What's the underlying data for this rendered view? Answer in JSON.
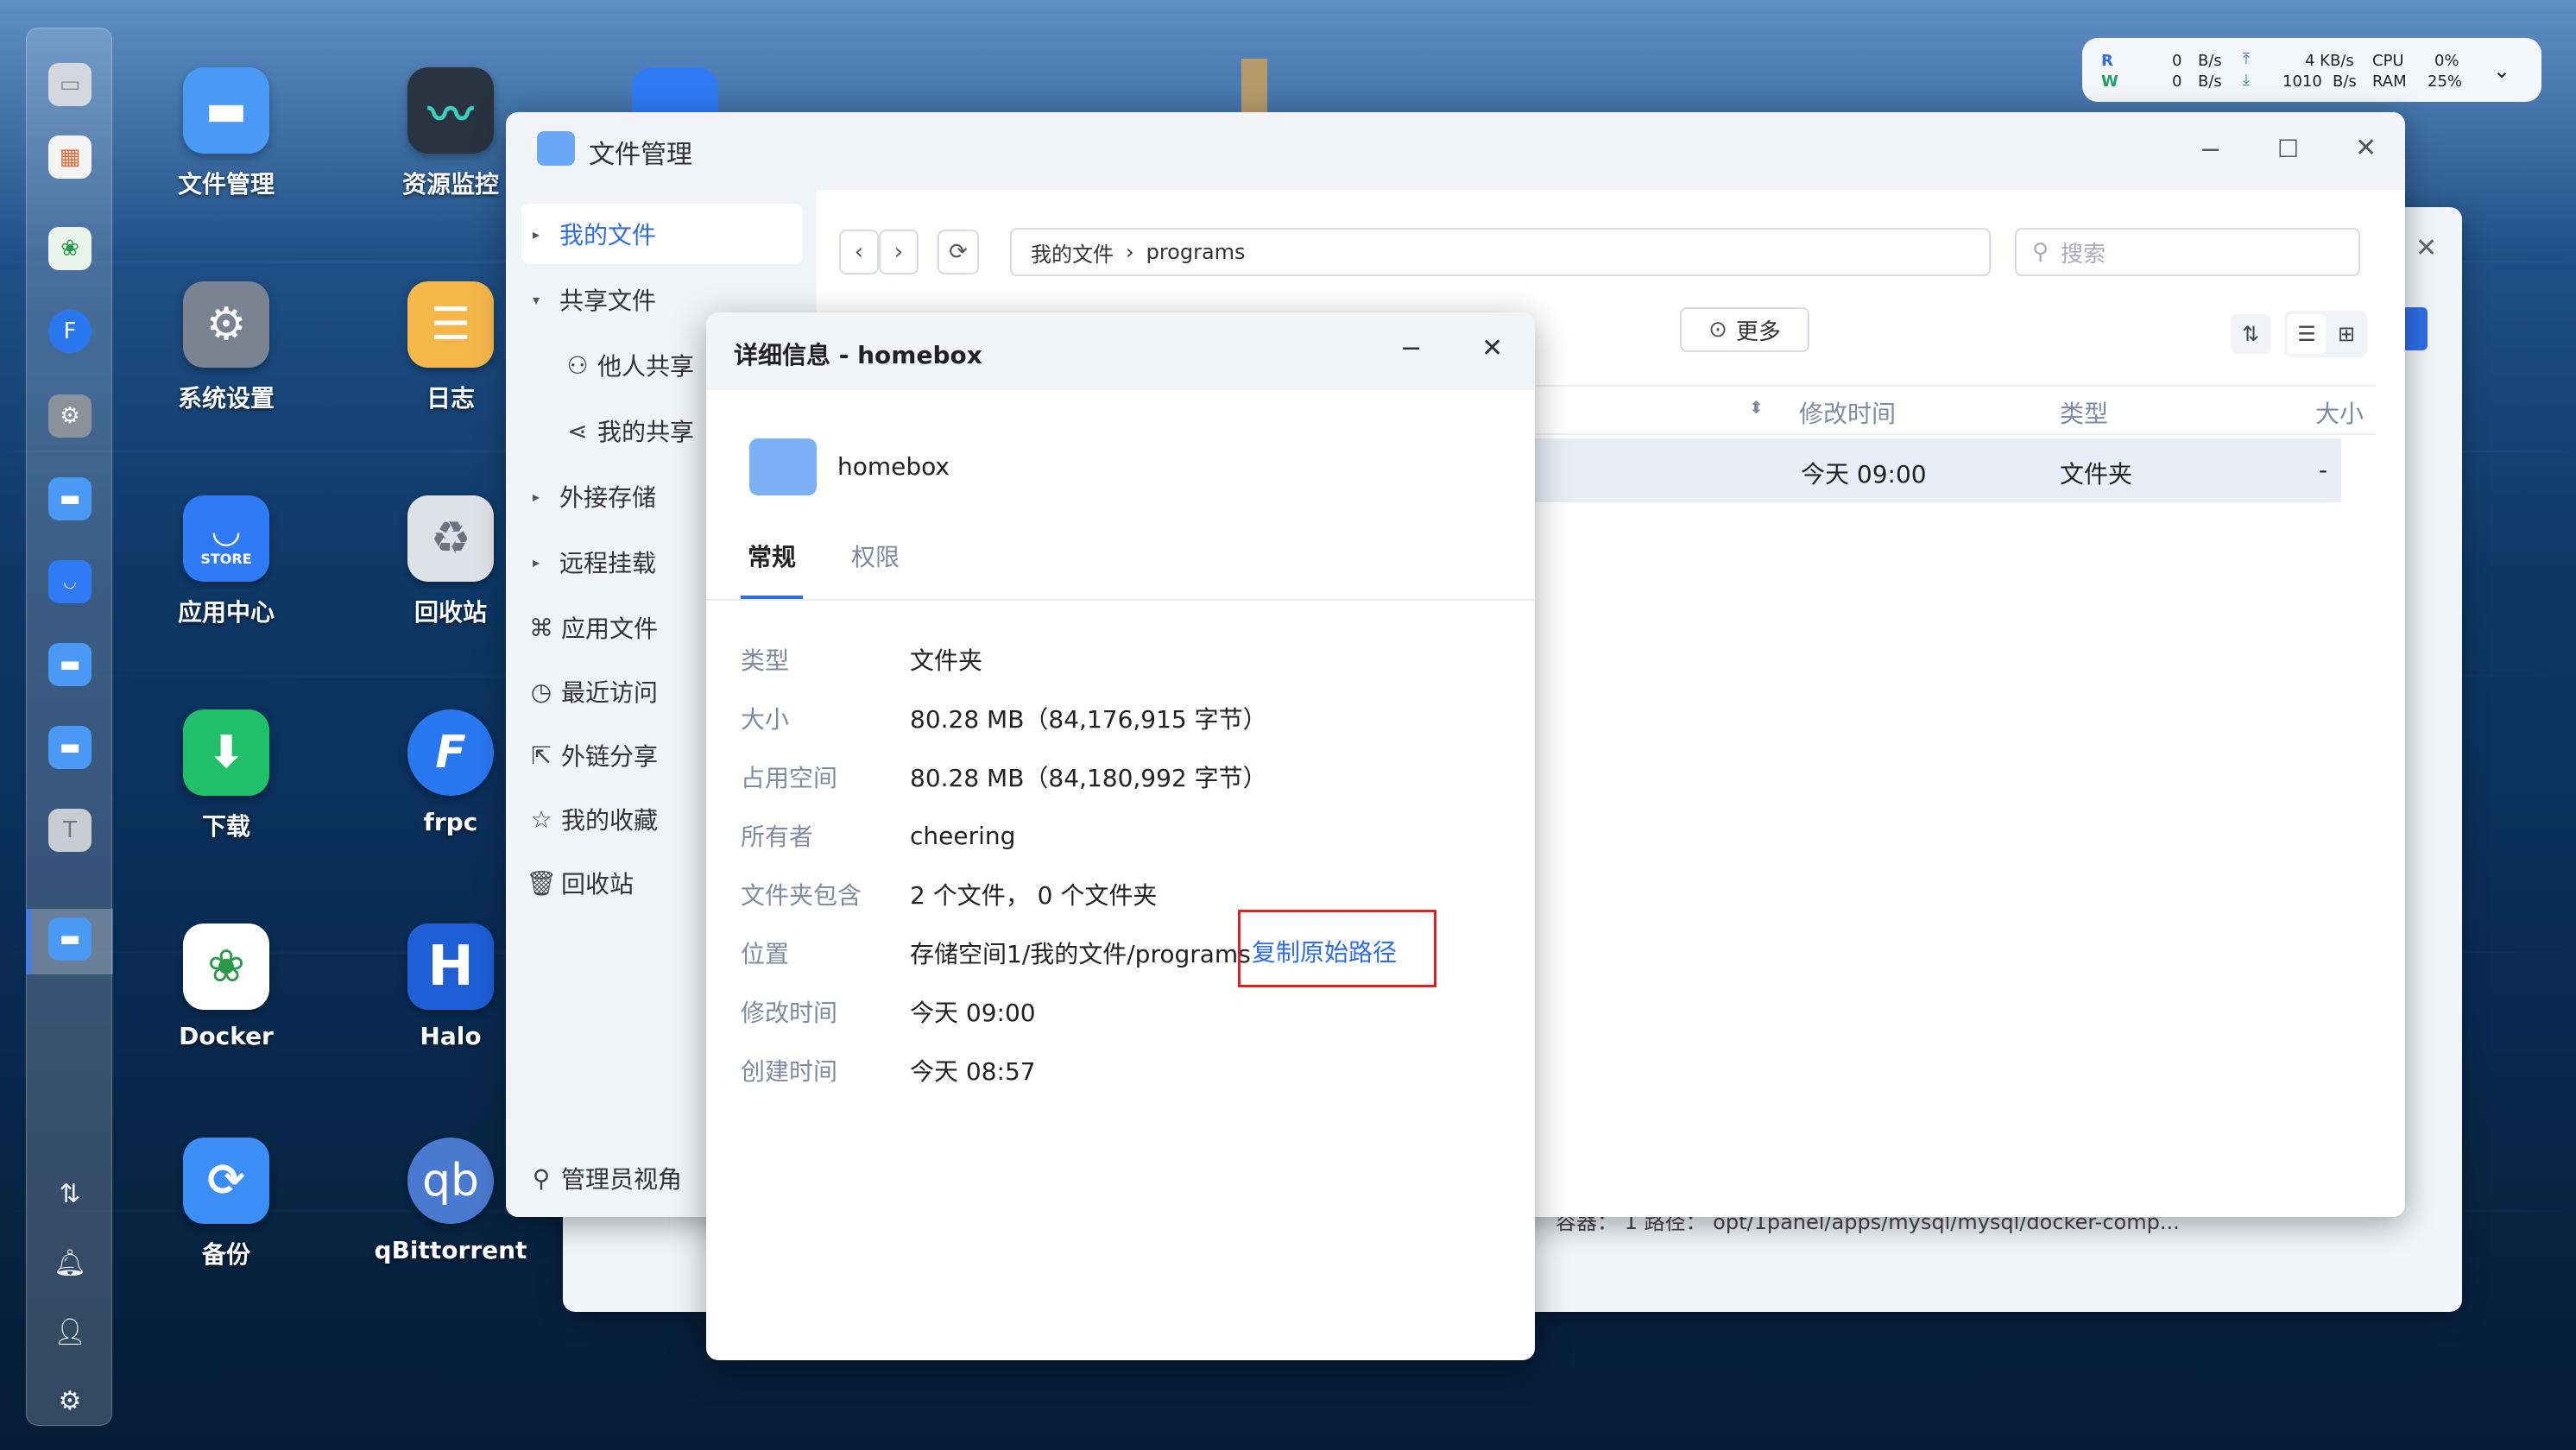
{
  "desktop": {
    "icons": [
      {
        "label": "文件管理",
        "icon": "folder-icon",
        "color": "#4a9af5"
      },
      {
        "label": "资源监控",
        "icon": "monitor-icon",
        "color": "#2a3440"
      },
      {
        "label": "系统设置",
        "icon": "gear-icon",
        "color": "#7a8392"
      },
      {
        "label": "日志",
        "icon": "log-icon",
        "color": "#f5b64a"
      },
      {
        "label": "应用中心",
        "icon": "store-icon",
        "color": "#2f7af5"
      },
      {
        "label": "回收站",
        "icon": "recycle-icon",
        "color": "#dfe3e8"
      },
      {
        "label": "下载",
        "icon": "download-icon",
        "color": "#20c06a"
      },
      {
        "label": "frpc",
        "icon": "frpc-icon",
        "color": "#2a78f0"
      },
      {
        "label": "Docker",
        "icon": "docker-icon",
        "color": "#ffffff"
      },
      {
        "label": "Halo",
        "icon": "halo-icon",
        "color": "#1e5fd8"
      },
      {
        "label": "备份",
        "icon": "backup-icon",
        "color": "#3a8ef5"
      },
      {
        "label": "qBittorrent",
        "icon": "qbittorrent-icon",
        "color": "#4a7ad0"
      }
    ],
    "store_text": "STORE",
    "halo_letter": "H",
    "qb_text": "qb"
  },
  "status_widget": {
    "r_label": "R",
    "w_label": "W",
    "r_value": "0",
    "w_value": "0",
    "r_unit": "B/s",
    "w_unit": "B/s",
    "up_value": "4 KB/s",
    "down_value": "1010",
    "down_unit": "B/s",
    "cpu_label": "CPU",
    "ram_label": "RAM",
    "cpu_value": "0%",
    "ram_value": "25%"
  },
  "file_manager": {
    "title": "文件管理",
    "sidebar": [
      {
        "label": "我的文件",
        "active": true,
        "arrow": "▸"
      },
      {
        "label": "共享文件",
        "arrow": "▾"
      },
      {
        "label": "他人共享",
        "icon": "users-icon"
      },
      {
        "label": "我的共享",
        "icon": "share-icon"
      },
      {
        "label": "外接存储",
        "arrow": "▸"
      },
      {
        "label": "远程挂载",
        "arrow": "▸"
      },
      {
        "label": "应用文件",
        "icon": "apps-icon"
      },
      {
        "label": "最近访问",
        "icon": "clock-icon"
      },
      {
        "label": "外链分享",
        "icon": "link-share-icon"
      },
      {
        "label": "我的收藏",
        "icon": "star-icon"
      },
      {
        "label": "回收站",
        "icon": "trash-icon"
      }
    ],
    "admin_view": "管理员视角",
    "breadcrumb": {
      "root": "我的文件",
      "sep": "›",
      "current": "programs"
    },
    "search_placeholder": "搜索",
    "more_button": "更多",
    "columns": {
      "modified": "修改时间",
      "type": "类型",
      "size": "大小"
    },
    "row": {
      "modified": "今天 09:00",
      "type": "文件夹",
      "size": "-"
    },
    "back_status": "容器： 1     路径： opt/1panel/apps/mysql/mysql/docker-comp..."
  },
  "detail_dialog": {
    "title": "详细信息 - homebox",
    "name": "homebox",
    "tabs": [
      "常规",
      "权限"
    ],
    "props": [
      {
        "key": "类型",
        "value": "文件夹"
      },
      {
        "key": "大小",
        "value": "80.28 MB（84,176,915 字节）"
      },
      {
        "key": "占用空间",
        "value": "80.28 MB（84,180,992 字节）"
      },
      {
        "key": "所有者",
        "value": "cheering"
      },
      {
        "key": "文件夹包含",
        "value": "2 个文件， 0 个文件夹"
      },
      {
        "key": "位置",
        "value": "存储空间1/我的文件/programs"
      },
      {
        "key": "修改时间",
        "value": "今天 09:00"
      },
      {
        "key": "创建时间",
        "value": "今天 08:57"
      }
    ],
    "copy_path_link": "复制原始路径"
  }
}
